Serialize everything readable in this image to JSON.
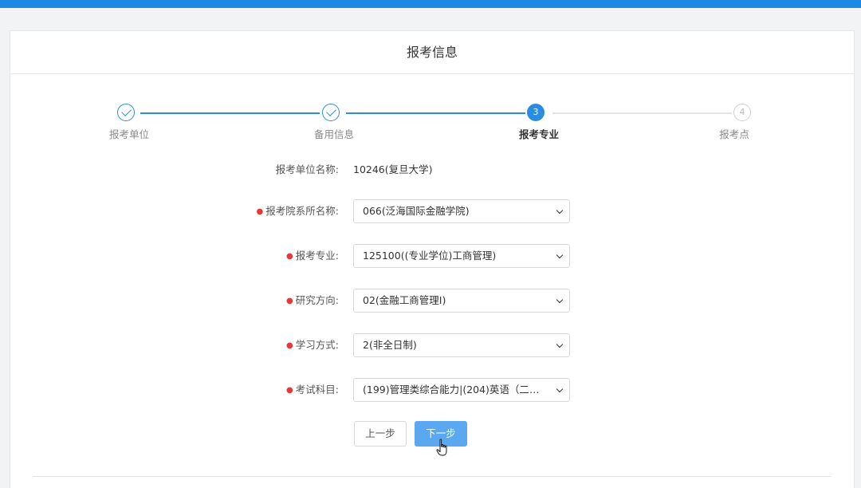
{
  "panel": {
    "title": "报考信息"
  },
  "stepper": {
    "steps": [
      {
        "label": "报考单位",
        "state": "done",
        "num": "1"
      },
      {
        "label": "备用信息",
        "state": "done",
        "num": "2"
      },
      {
        "label": "报考专业",
        "state": "active",
        "num": "3"
      },
      {
        "label": "报考点",
        "state": "todo",
        "num": "4"
      }
    ]
  },
  "form": {
    "unit_label": "报考单位名称:",
    "unit_value": "10246(复旦大学)",
    "department": {
      "label": "报考院系所名称:",
      "value": "066(泛海国际金融学院)"
    },
    "major": {
      "label": "报考专业:",
      "value": "125100((专业学位)工商管理)"
    },
    "direction": {
      "label": "研究方向:",
      "value": "02(金融工商管理I)"
    },
    "study_mode": {
      "label": "学习方式:",
      "value": "2(非全日制)"
    },
    "exam_subjects": {
      "label": "考试科目:",
      "value": "(199)管理类综合能力|(204)英语（二）|(-..."
    }
  },
  "buttons": {
    "prev": "上一步",
    "next": "下一步"
  },
  "colors": {
    "primary": "#2b8ce0",
    "topbar": "#1e88e5",
    "required": "#e53935"
  }
}
